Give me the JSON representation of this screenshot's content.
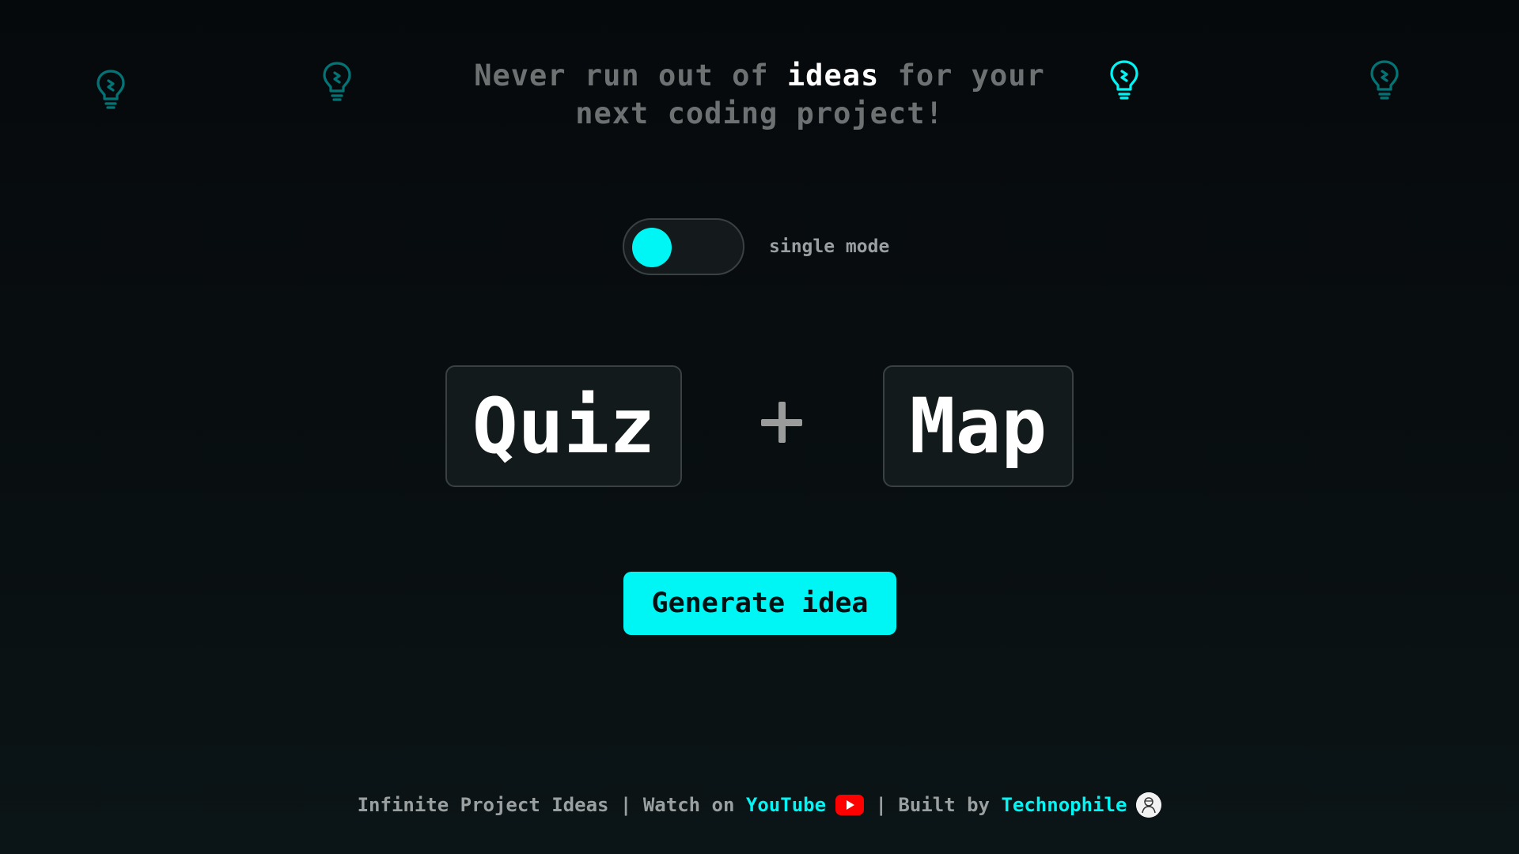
{
  "headline": {
    "before": "Never run out of ",
    "highlight": "ideas",
    "after": " for your next coding project!"
  },
  "mode_toggle": {
    "label": "single mode",
    "state": "off"
  },
  "idea": {
    "word_1": "Quiz",
    "word_2": "Map"
  },
  "generate_button": {
    "label": "Generate idea"
  },
  "footer": {
    "app_name": "Infinite Project Ideas",
    "separator": " | ",
    "watch_text": "Watch on ",
    "youtube_label": "YouTube",
    "built_text": "Built by ",
    "author_label": "Technophile"
  },
  "icons": {
    "bulbs": [
      "lightbulb-icon",
      "lightbulb-icon",
      "lightbulb-icon",
      "lightbulb-icon"
    ],
    "youtube": "youtube-icon",
    "avatar": "avatar"
  },
  "colors": {
    "accent": "#00f5f5",
    "background": "#080e10",
    "card_bg": "#131a1b",
    "muted_text": "#6d7172",
    "youtube_red": "#ff0000"
  }
}
